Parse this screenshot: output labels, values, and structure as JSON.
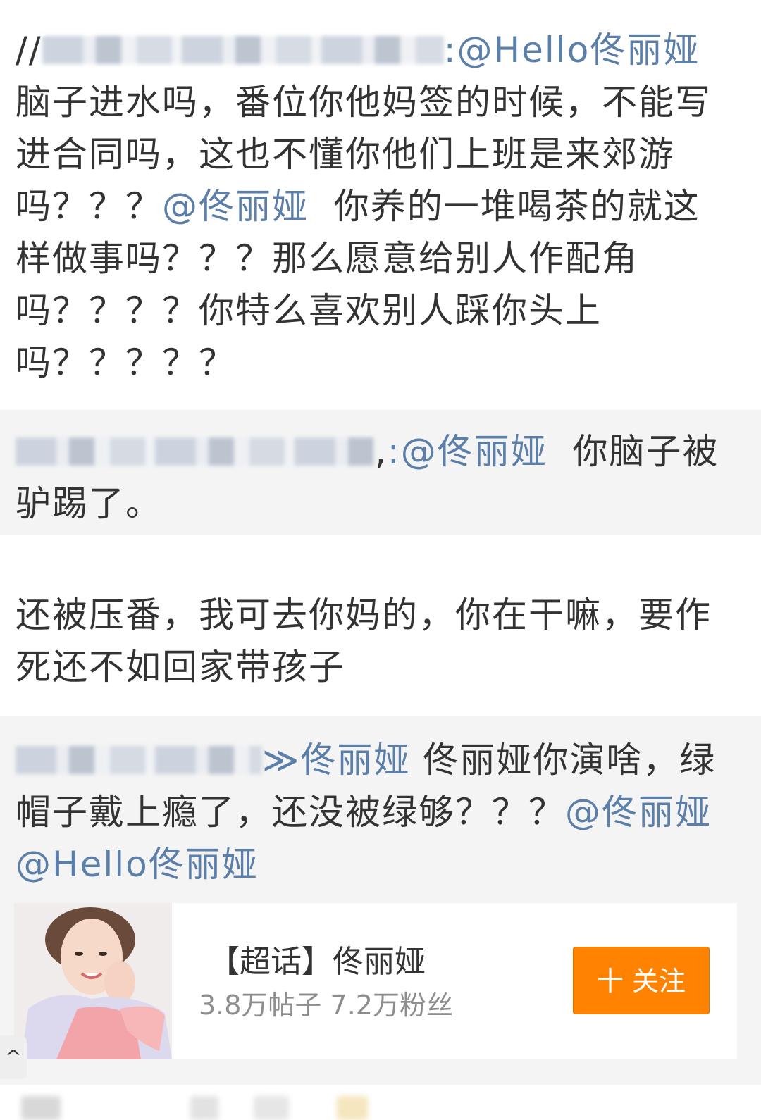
{
  "post1": {
    "prefix": "//",
    "mention_tail": ":@Hello佟丽娅",
    "text1": "脑子进水吗，番位你他妈签的时候，不能写进合同吗，这也不懂你他们上班是来郊游吗？？？",
    "mention": "@佟丽娅",
    "text2": "  你养的一堆喝茶的就这样做事吗？？？那么愿意给别人作配角吗？？？？你特么喜欢别人踩你头上吗？？？？？"
  },
  "reply1": {
    "sep": ",",
    "mention": ":@佟丽娅",
    "text": "  你脑子被驴踢了。"
  },
  "post2": {
    "text": "还被压番，我可去你妈的，你在干嘛，要作死还不如回家带孩子"
  },
  "reply2": {
    "mention_prefix": "≫佟丽娅",
    "text": " 佟丽娅你演啥，绿帽子戴上瘾了，还没被绿够？？？",
    "mention1": "@佟丽娅",
    "mention2": "@Hello佟丽娅"
  },
  "card": {
    "title": "【超话】佟丽娅",
    "stats": "3.8万帖子 7.2万粉丝",
    "follow_label": "十 关注"
  },
  "scroll_top": {
    "icon": "^"
  },
  "colors": {
    "mention": "#5b7fa8",
    "follow_button": "#ff8200",
    "text": "#333333",
    "reply_bg": "#f4f4f4"
  }
}
